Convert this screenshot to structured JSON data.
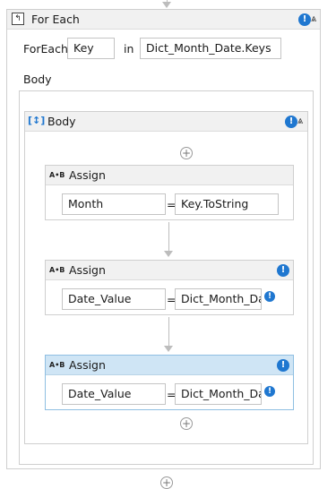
{
  "foreach": {
    "title": "For Each",
    "foreach_label": "ForEach",
    "item_var": "Key",
    "in_label": "in",
    "collection": "Dict_Month_Date.Keys",
    "body_label": "Body"
  },
  "sequence": {
    "title": "Body"
  },
  "assigns": [
    {
      "title": "Assign",
      "to": "Month",
      "op": "=",
      "value": "Key.ToString"
    },
    {
      "title": "Assign",
      "to": "Date_Value",
      "op": "=",
      "value": "Dict_Month_Dat"
    },
    {
      "title": "Assign",
      "to": "Date_Value",
      "op": "=",
      "value": "Dict_Month_Dat"
    }
  ],
  "icons": {
    "warning": "!",
    "collapse": "⩓",
    "add": "+",
    "assign_glyph": "A•B"
  },
  "colors": {
    "selected_header": "#cfe5f5",
    "warning_blue": "#1f77d0"
  }
}
